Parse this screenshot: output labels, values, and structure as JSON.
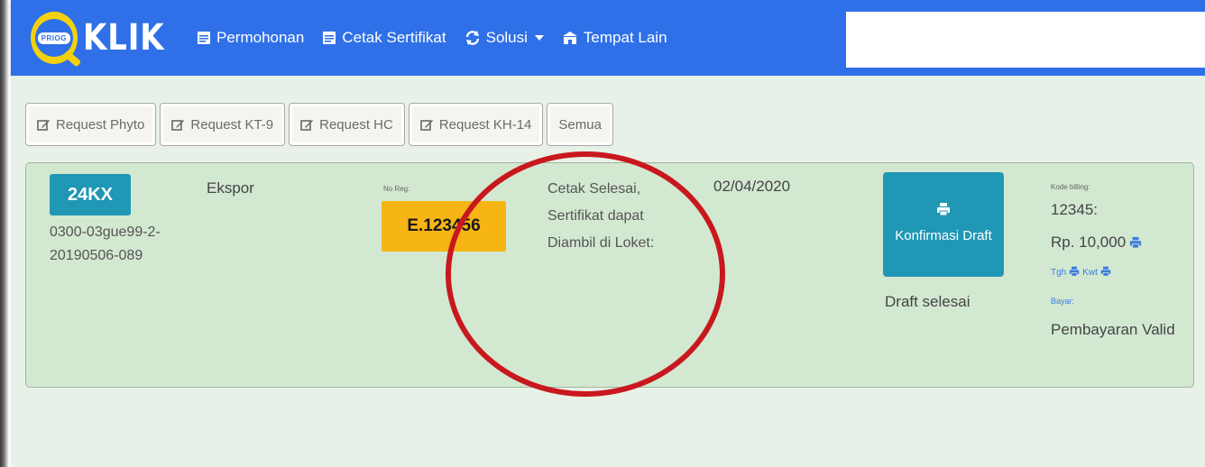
{
  "app": {
    "brand_name": "KLIK",
    "logo_badge_text": "PRIOG"
  },
  "nav": {
    "items": [
      {
        "label": "Permohonan",
        "icon": "document-icon"
      },
      {
        "label": "Cetak Sertifikat",
        "icon": "document-icon"
      },
      {
        "label": "Solusi",
        "icon": "refresh-icon",
        "has_dropdown": true
      },
      {
        "label": "Tempat Lain",
        "icon": "building-icon"
      }
    ]
  },
  "filters": {
    "buttons": [
      {
        "label": "Request Phyto",
        "icon": "edit-icon"
      },
      {
        "label": "Request KT-9",
        "icon": "edit-icon"
      },
      {
        "label": "Request HC",
        "icon": "edit-icon"
      },
      {
        "label": "Request KH-14",
        "icon": "edit-icon"
      },
      {
        "label": "Semua"
      }
    ]
  },
  "record": {
    "code_badge": "24KX",
    "request_id": "0300-03gue99-2-20190506-089",
    "type": "Ekspor",
    "noreg_label": "No Reg:",
    "noreg_value": "E.123456",
    "status": "Cetak Selesai, Sertifikat dapat Diambil di Loket:",
    "date": "02/04/2020",
    "confirm_button": "Konfirmasi Draft",
    "draft_status": "Draft selesai",
    "billing_label": "Kode billing:",
    "billing_code": "12345:",
    "billing_amount": "Rp. 10,000",
    "link_tgh": "Tgh",
    "link_kwt": "Kwt",
    "bayar_label": "Bayar:",
    "payment_status": "Pembayaran Valid"
  },
  "colors": {
    "navbar": "#2f70e8",
    "accent_teal": "#1f97b5",
    "badge_yellow": "#f7b515",
    "card_bg": "#d3e8d1",
    "annotation_red": "#c8181e"
  }
}
